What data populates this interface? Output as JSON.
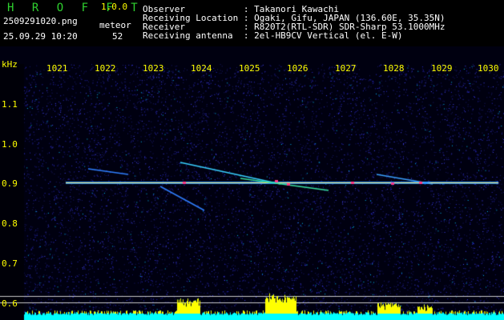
{
  "header": {
    "logo": "H R O F F T",
    "version": "1.0.0",
    "filename": "2509291020.png",
    "datetime": "25.09.29 10:20",
    "meteor_label": "meteor",
    "meteor_count": "52",
    "info_lines": [
      "Observer           : Takanori Kawachi",
      "Receiving Location : Ogaki, Gifu, JAPAN (136.60E, 35.35N)",
      "Receiver           : R820T2(RTL-SDR) SDR-Sharp 53.1000MHz",
      "Receiving antenna  : 2el-HB9CV Vertical (el. E-W)"
    ]
  },
  "axes": {
    "x_ticks": [
      "1021",
      "1022",
      "1023",
      "1024",
      "1025",
      "1026",
      "1027",
      "1028",
      "1029",
      "1030"
    ],
    "y_unit": "kHz",
    "y_ticks": [
      "1.1",
      "1.0",
      "0.9",
      "0.8",
      "0.7",
      "0.6"
    ]
  },
  "colors": {
    "background": "#000010",
    "carrier": "#ffe15a",
    "bar_yellow": "#ffff00",
    "bar_cyan": "#00ffff",
    "label": "#ffff00",
    "logo": "#2fd12f"
  }
}
